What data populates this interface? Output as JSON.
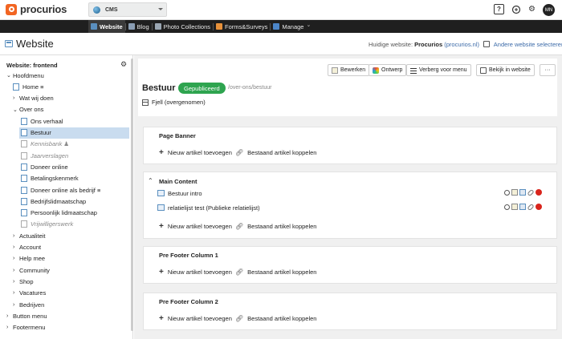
{
  "app": {
    "logo_text": "procurios",
    "context": "CMS",
    "avatar": "MN",
    "help_glyph": "?"
  },
  "nav": {
    "items": [
      {
        "label": "Website",
        "active": true,
        "icon": "website-icon"
      },
      {
        "label": "Blog",
        "icon": "blog-icon"
      },
      {
        "label": "Photo Collections",
        "icon": "photo-icon"
      },
      {
        "label": "Forms&Surveys",
        "icon": "forms-icon"
      },
      {
        "label": "Manage",
        "icon": "manage-icon",
        "caret": "⌄"
      }
    ]
  },
  "site_header": {
    "title": "Website",
    "live_label": "Huidige website:",
    "live_name": "Procurios",
    "live_domain": "(procurios.nl)",
    "select_other": "Andere website selecteren"
  },
  "sidebar": {
    "heading": "Website: frontend",
    "tree": [
      {
        "label": "Hoofdmenu",
        "chev": "⌄"
      },
      {
        "label": "Home ≡",
        "page": true
      },
      {
        "label": "Wat wij doen",
        "chev": "›"
      },
      {
        "label": "Over ons",
        "chev": "⌄"
      },
      {
        "label": "Ons verhaal",
        "page": true
      },
      {
        "label": "Bestuur",
        "page": true,
        "selected": true
      },
      {
        "label": "Kennisbank ♟",
        "page": true,
        "hidden": true
      },
      {
        "label": "Jaarverslagen",
        "page": true,
        "hidden": true
      },
      {
        "label": "Doneer online",
        "page": true
      },
      {
        "label": "Betalingskenmerk",
        "page": true
      },
      {
        "label": "Doneer online als bedrijf ≡",
        "page": true
      },
      {
        "label": "Bedrijfslidmaatschap",
        "page": true
      },
      {
        "label": "Persoonlijk lidmaatschap",
        "page": true
      },
      {
        "label": "Vrijwilligerswerk",
        "page": true,
        "hidden": true
      },
      {
        "label": "Actualiteit",
        "chev": "›"
      },
      {
        "label": "Account",
        "chev": "›"
      },
      {
        "label": "Help mee",
        "chev": "›"
      },
      {
        "label": "Community",
        "chev": "›"
      },
      {
        "label": "Shop",
        "chev": "›"
      },
      {
        "label": "Vacatures",
        "chev": "›"
      },
      {
        "label": "Bedrijven",
        "chev": "›"
      },
      {
        "label": "Button menu",
        "chev": "›"
      },
      {
        "label": "Footermenu",
        "chev": "›"
      }
    ]
  },
  "toolbar": {
    "edit": "Bewerken",
    "design": "Ontwerp",
    "hide": "Verberg voor menu",
    "view": "Bekijk in website",
    "more": "···"
  },
  "page": {
    "name": "Bestuur",
    "status": "Gepubliceerd",
    "path": "/over-ons/bestuur",
    "theme": "Fjell (overgenomen)"
  },
  "sections": [
    {
      "title": "Page Banner",
      "items": []
    },
    {
      "title": "Main Content",
      "items": [
        {
          "label": "Bestuur intro"
        },
        {
          "label": "relatielijst test (Publieke relatielijst)"
        }
      ]
    },
    {
      "title": "Pre Footer Column 1",
      "items": []
    },
    {
      "title": "Pre Footer Column 2",
      "items": []
    }
  ],
  "actions": {
    "new_article": "Nieuw artikel toevoegen",
    "link_article": "Bestaand artikel koppelen"
  },
  "colors": {
    "brand": "#f26522",
    "published": "#2ea44f",
    "selected": "#c9dcef",
    "nav_bg": "#1f1f1f",
    "link": "#3b6aa8"
  }
}
